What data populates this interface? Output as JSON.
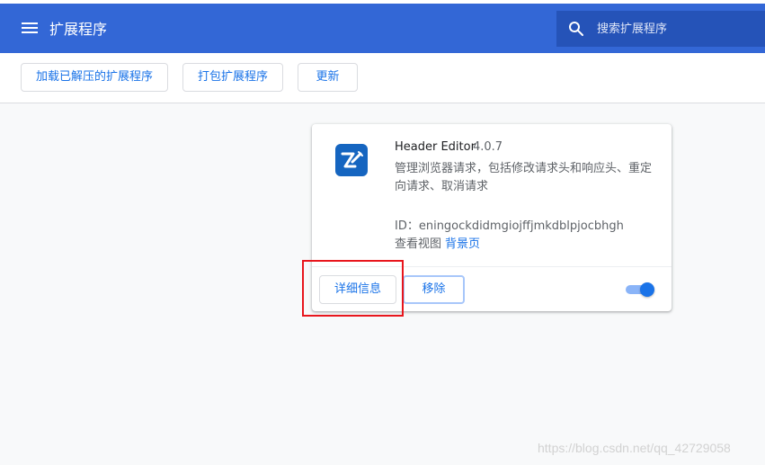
{
  "header": {
    "title": "扩展程序",
    "menu_icon": "menu-icon",
    "search_placeholder": "搜索扩展程序",
    "search_value": "",
    "accent_color": "#3367d6"
  },
  "toolbar": {
    "load_unpacked_label": "加载已解压的扩展程序",
    "pack_label": "打包扩展程序",
    "update_label": "更新"
  },
  "extension": {
    "name": "Header Editor",
    "version": "4.0.7",
    "description": "管理浏览器请求，包括修改请求头和响应头、重定向请求、取消请求",
    "id_text": "ID：eningockdidmgiojffjmkdblpjocbhgh",
    "views_label": "查看视图",
    "views_link": "背景页",
    "details_button": "详细信息",
    "remove_button": "移除",
    "enabled": true,
    "icon": "header-editor-icon"
  },
  "annotation": {
    "highlight_color": "#e8161d"
  },
  "watermark": "https://blog.csdn.net/qq_42729058"
}
